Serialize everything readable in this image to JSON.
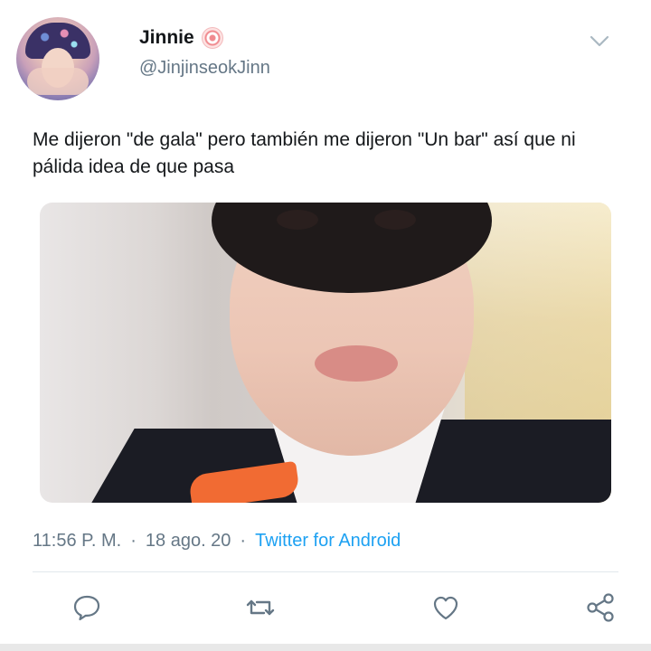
{
  "user": {
    "display_name": "Jinnie",
    "handle": "@JinjinseokJinn",
    "name_emoji": "fish-cake-emoji"
  },
  "tweet": {
    "text": "Me dijeron \"de gala\" pero también me dijeron \"Un bar\" así que ni pálida idea de que pasa"
  },
  "meta": {
    "time": "11:56 P. M.",
    "separator": "·",
    "date": "18 ago. 20",
    "source": "Twitter for Android"
  },
  "actions": [
    {
      "icon": "reply-icon"
    },
    {
      "icon": "retweet-icon"
    },
    {
      "icon": "like-icon"
    },
    {
      "icon": "share-icon"
    }
  ],
  "colors": {
    "text": "#14171a",
    "secondary": "#657786",
    "link": "#1da1f2",
    "divider": "#e1e8ed"
  }
}
